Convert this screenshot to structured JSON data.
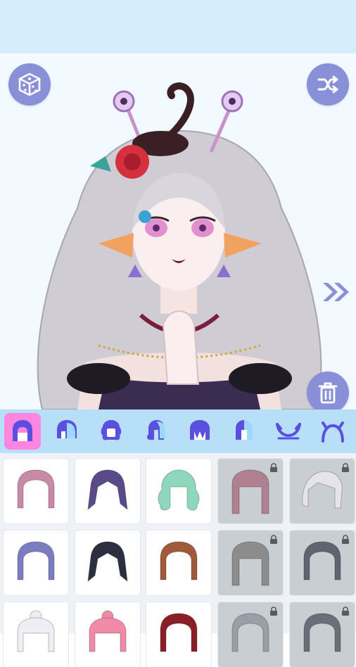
{
  "colors": {
    "accent": "#8a90d8",
    "tab_active": "#ff86e0",
    "tab_icon": "#5b4fe0",
    "locked_tile": "#c9ced3"
  },
  "toolbar": {
    "random_icon": "dice-icon",
    "shuffle_icon": "shuffle-icon",
    "next_icon": "double-chevron-right-icon",
    "delete_icon": "trash-icon"
  },
  "tabs": [
    {
      "id": "hair-full",
      "active": true
    },
    {
      "id": "hair-front"
    },
    {
      "id": "hair-back-curly"
    },
    {
      "id": "hair-side-tail"
    },
    {
      "id": "hair-bangs"
    },
    {
      "id": "hair-half"
    },
    {
      "id": "horns"
    },
    {
      "id": "antlers"
    }
  ],
  "hair_options": [
    {
      "color": "#c98aa8",
      "locked": false,
      "style": "bob"
    },
    {
      "color": "#5b4a8a",
      "locked": false,
      "style": "shaggy"
    },
    {
      "color": "#8ed7bd",
      "locked": false,
      "style": "curly"
    },
    {
      "color": "#b08090",
      "locked": true,
      "style": "long"
    },
    {
      "color": "#e6e3ea",
      "locked": true,
      "style": "swept"
    },
    {
      "color": "#7a7ec0",
      "locked": false,
      "style": "bob"
    },
    {
      "color": "#2b2f3e",
      "locked": false,
      "style": "shaggy"
    },
    {
      "color": "#a05a3a",
      "locked": false,
      "style": "braid"
    },
    {
      "color": "#8c8c8c",
      "locked": true,
      "style": "long"
    },
    {
      "color": "#5e6470",
      "locked": true,
      "style": "bob"
    },
    {
      "color": "#f0eef5",
      "locked": false,
      "style": "bun"
    },
    {
      "color": "#f08aa8",
      "locked": false,
      "style": "bun"
    },
    {
      "color": "#8a1f28",
      "locked": false,
      "style": "bob"
    },
    {
      "color": "#9a9ea6",
      "locked": true,
      "style": "bob"
    },
    {
      "color": "#6a6e78",
      "locked": true,
      "style": "bob"
    }
  ]
}
